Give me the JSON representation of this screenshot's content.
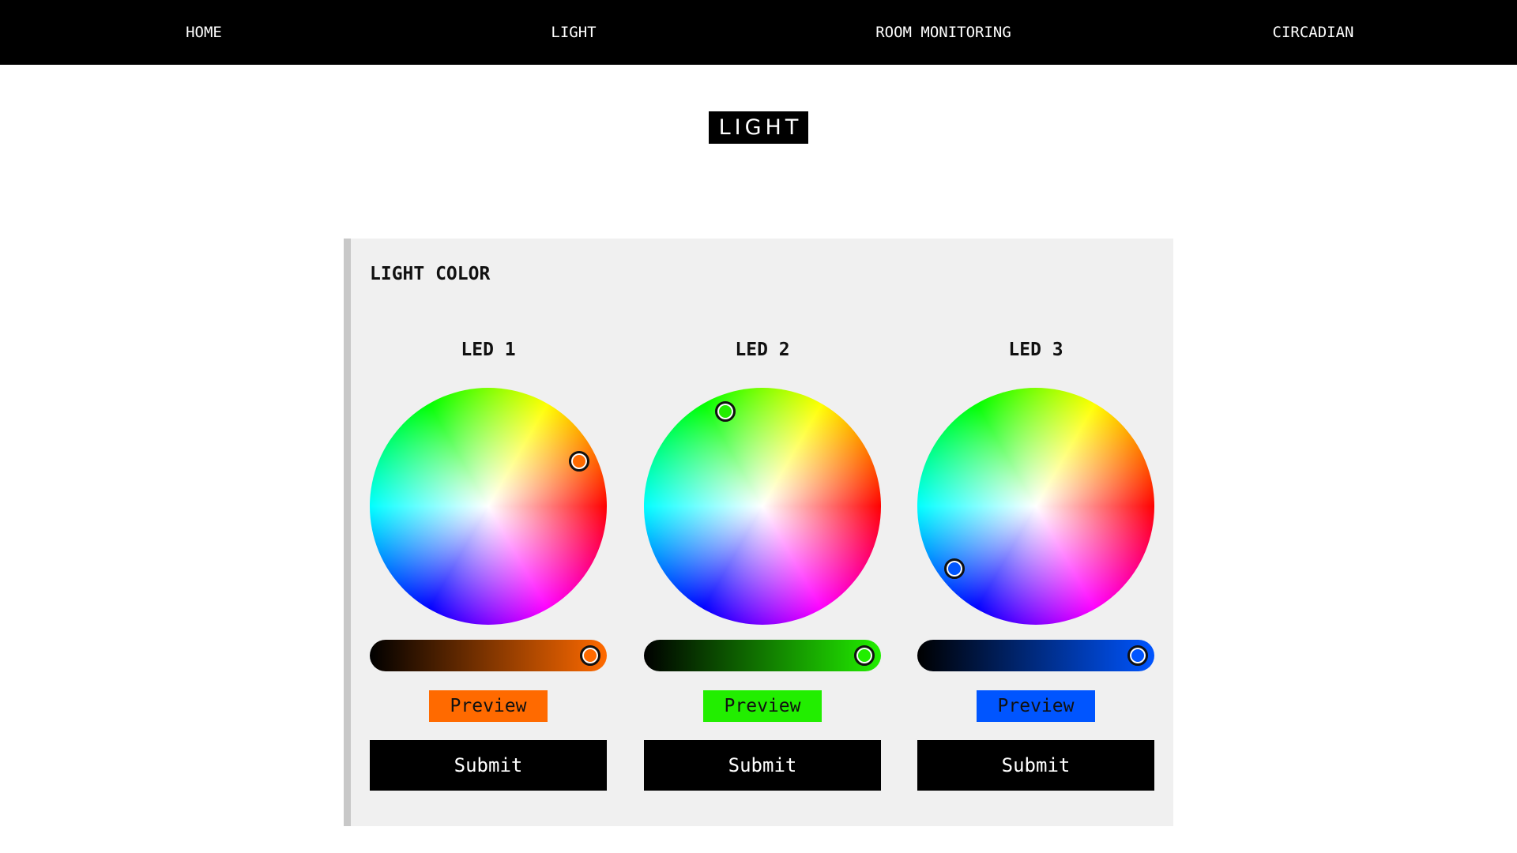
{
  "nav": {
    "items": [
      {
        "label": "HOME"
      },
      {
        "label": "LIGHT"
      },
      {
        "label": "ROOM MONITORING"
      },
      {
        "label": "CIRCADIAN"
      }
    ]
  },
  "page": {
    "title": "LIGHT"
  },
  "panel": {
    "title": "LIGHT COLOR",
    "leds": [
      {
        "name": "LED 1",
        "color": "#ff6a00",
        "brightness_percent": 100,
        "preview_label": "Preview",
        "submit_label": "Submit"
      },
      {
        "name": "LED 2",
        "color": "#22ee00",
        "brightness_percent": 100,
        "preview_label": "Preview",
        "submit_label": "Submit"
      },
      {
        "name": "LED 3",
        "color": "#0055ff",
        "brightness_percent": 100,
        "preview_label": "Preview",
        "submit_label": "Submit"
      }
    ]
  },
  "colors": {
    "nav_background": "#000000",
    "panel_background": "#f0f0f0",
    "panel_border": "#c8c8c8",
    "button_background": "#000000"
  }
}
